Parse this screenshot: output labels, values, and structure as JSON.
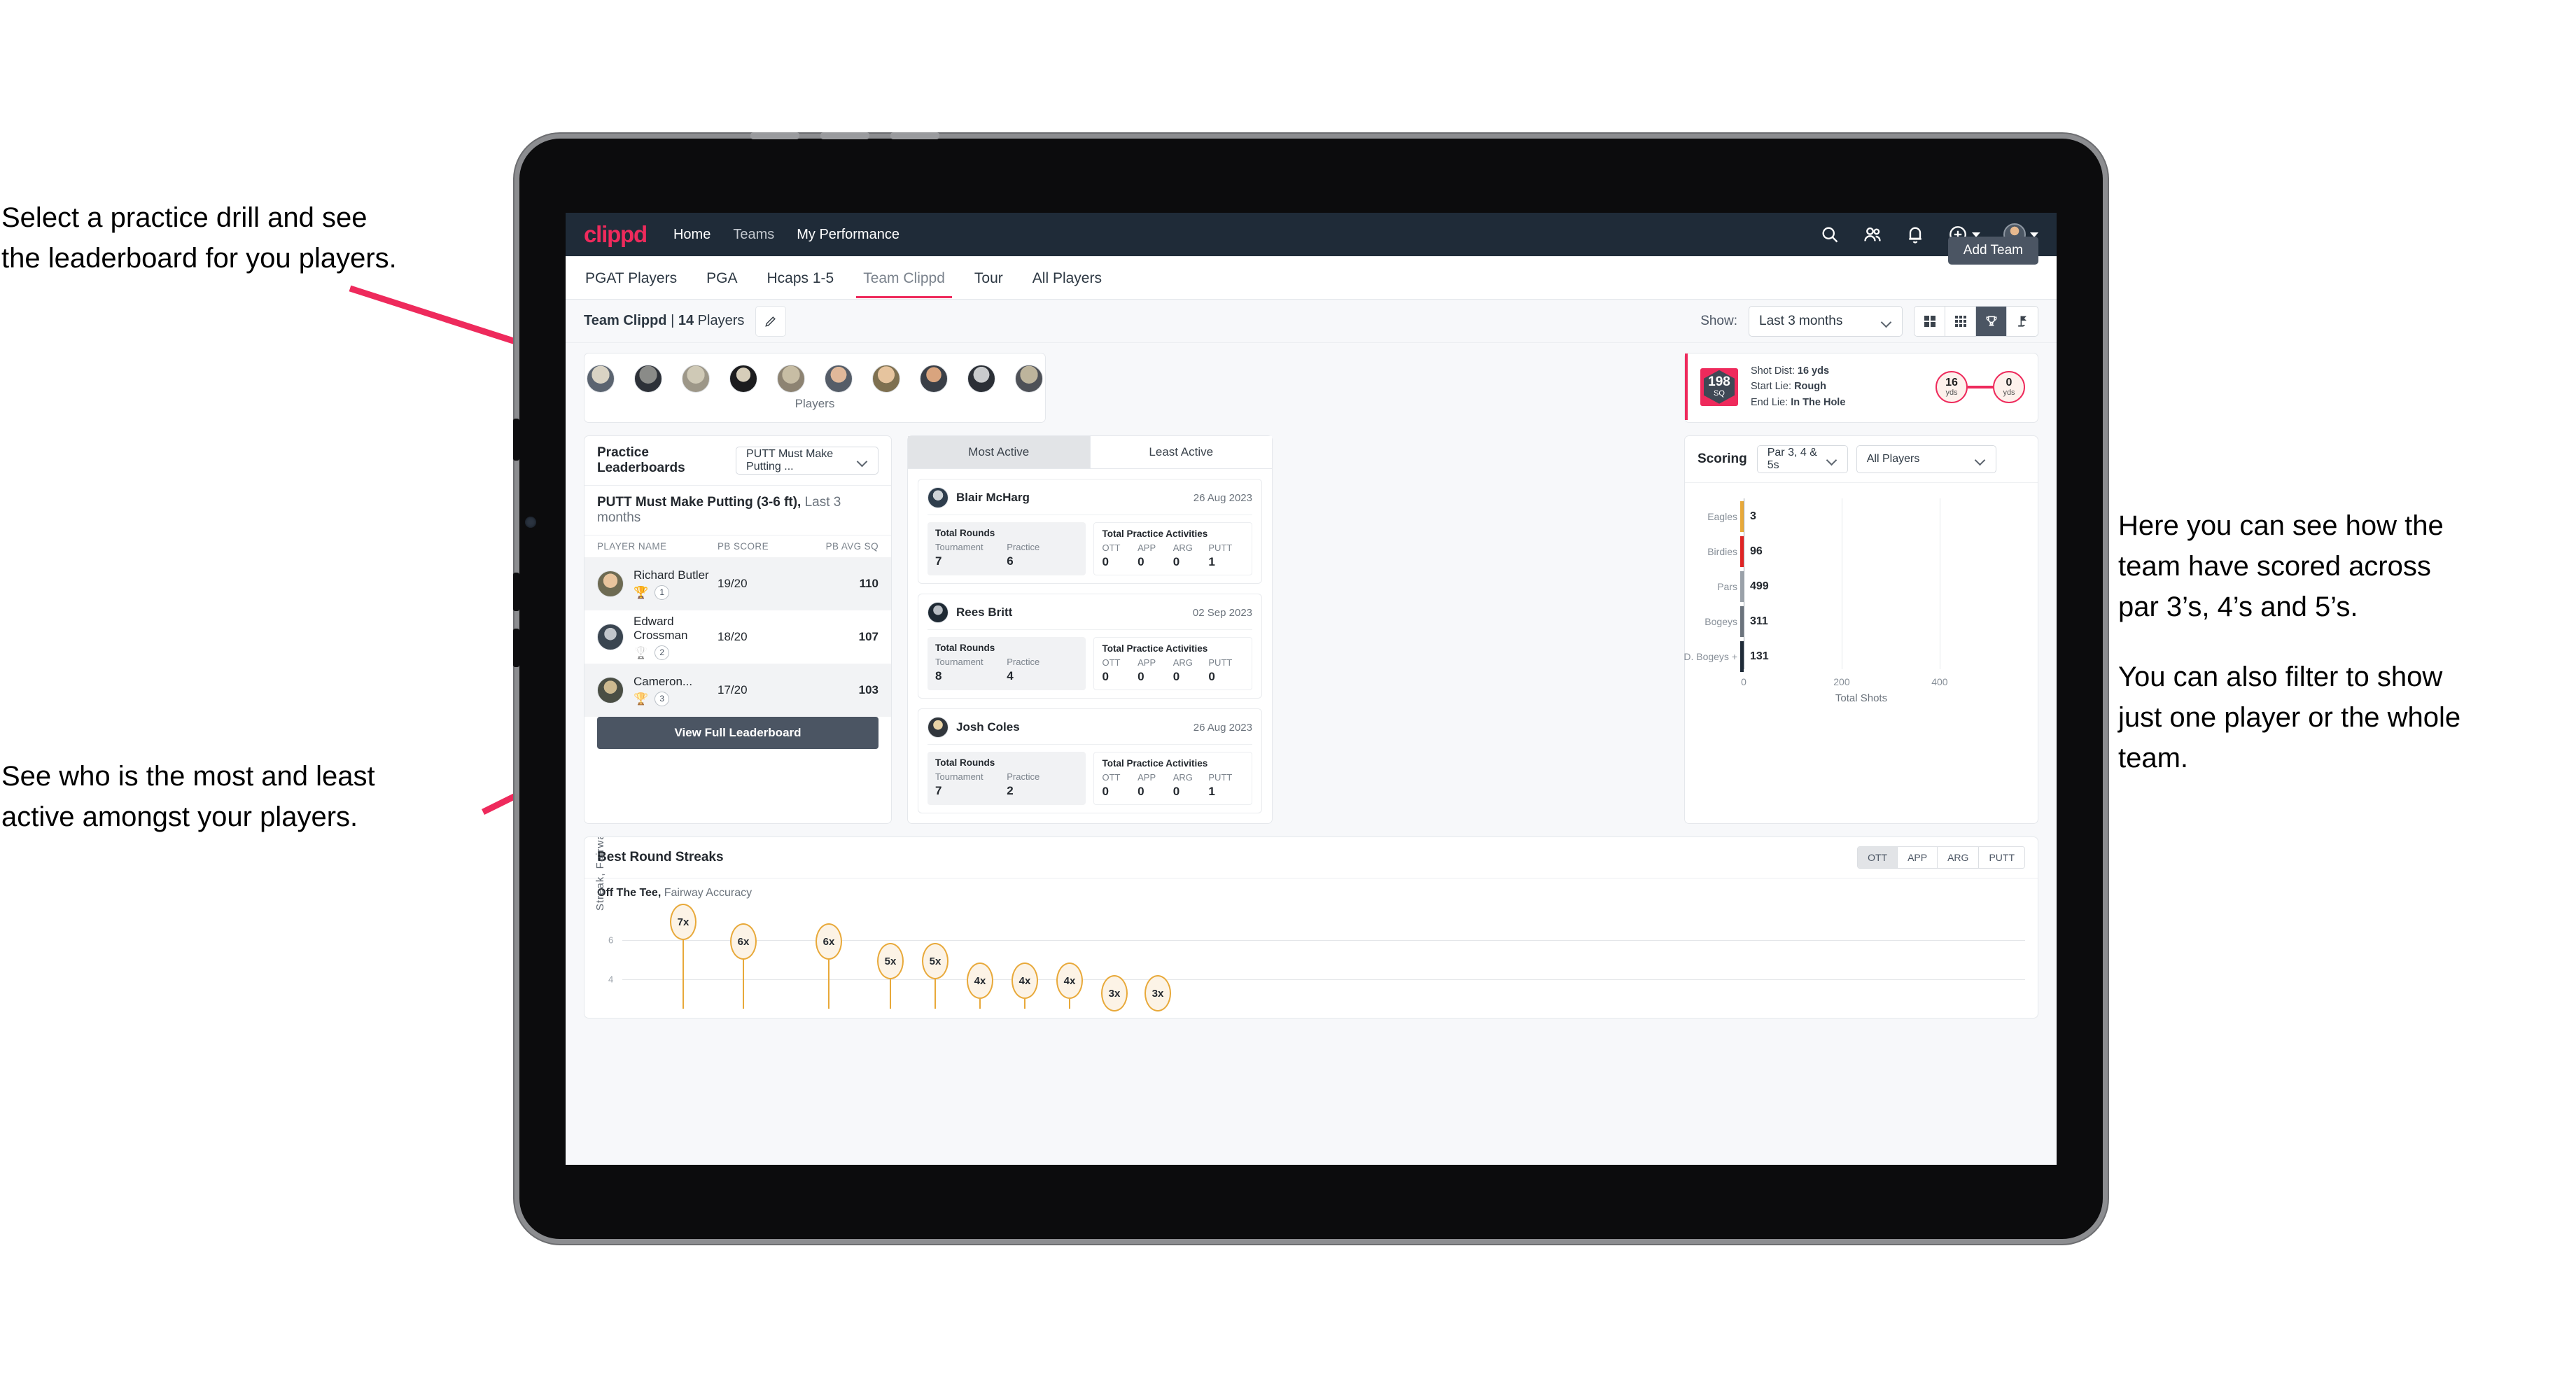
{
  "annotations": {
    "top_left": [
      "Select a practice drill and see",
      "the leaderboard for you players."
    ],
    "bottom_left": [
      "See who is the most and least",
      "active amongst your players."
    ],
    "right_1": [
      "Here you can see how the",
      "team have scored across",
      "par 3’s, 4’s and 5’s."
    ],
    "right_2": [
      "You can also filter to show",
      "just one player or the whole",
      "team."
    ]
  },
  "app": {
    "logo": "clippd",
    "nav": [
      {
        "label": "Home",
        "active": true
      },
      {
        "label": "Teams",
        "active": false
      },
      {
        "label": "My Performance",
        "active": true
      }
    ],
    "icons": [
      "search-icon",
      "people-icon",
      "bell-icon",
      "plus-circle-icon",
      "avatar"
    ],
    "accent": "#ee2a5c",
    "header_bg": "#1f2b38"
  },
  "tabs": [
    {
      "label": "PGAT Players",
      "active": false
    },
    {
      "label": "PGA",
      "active": false
    },
    {
      "label": "Hcaps 1-5",
      "active": false
    },
    {
      "label": "Team Clippd",
      "active": true
    },
    {
      "label": "Tour",
      "active": false
    },
    {
      "label": "All Players",
      "active": false
    }
  ],
  "add_team_button": "Add Team",
  "toolbar": {
    "team_name": "Team Clippd",
    "separator": "|",
    "player_count": "14",
    "players_word": "Players",
    "edit_icon": "pencil-icon",
    "show_label": "Show:",
    "range_value": "Last 3 months",
    "view_buttons": [
      "grid-large-icon",
      "grid-small-icon",
      "trophy-icon",
      "flag-icon"
    ],
    "active_view": "trophy-icon"
  },
  "players_strip": {
    "label": "Players",
    "count": 10
  },
  "shot_card": {
    "sq_value": "198",
    "sq_unit": "SQ",
    "lines": [
      {
        "label": "Shot Dist:",
        "value": "16 yds"
      },
      {
        "label": "Start Lie:",
        "value": "Rough"
      },
      {
        "label": "End Lie:",
        "value": "In The Hole"
      }
    ],
    "start_dist": {
      "n": "16",
      "u": "yds"
    },
    "end_dist": {
      "n": "0",
      "u": "yds"
    }
  },
  "leaderboard": {
    "title": "Practice Leaderboards",
    "drill_select": "PUTT Must Make Putting ...",
    "subtitle_bold": "PUTT Must Make Putting (3-6 ft),",
    "subtitle_dim": "Last 3 months",
    "columns": [
      "PLAYER NAME",
      "PB SCORE",
      "PB AVG SQ"
    ],
    "rows": [
      {
        "name": "Richard Butler",
        "rank": "1",
        "trophy": "gold",
        "score": "19/20",
        "sq": "110"
      },
      {
        "name": "Edward Crossman",
        "rank": "2",
        "trophy": "silver",
        "score": "18/20",
        "sq": "107"
      },
      {
        "name": "Cameron...",
        "rank": "3",
        "trophy": "bronze",
        "score": "17/20",
        "sq": "103"
      }
    ],
    "button": "View Full Leaderboard"
  },
  "activity": {
    "tabs": [
      {
        "label": "Most Active",
        "active": true
      },
      {
        "label": "Least Active",
        "active": false
      }
    ],
    "rounds_title": "Total Rounds",
    "practice_title": "Total Practice Activities",
    "rounds_keys": [
      "Tournament",
      "Practice"
    ],
    "practice_keys": [
      "OTT",
      "APP",
      "ARG",
      "PUTT"
    ],
    "cards": [
      {
        "name": "Blair McHarg",
        "date": "26 Aug 2023",
        "rounds": [
          "7",
          "6"
        ],
        "practice": [
          "0",
          "0",
          "0",
          "1"
        ]
      },
      {
        "name": "Rees Britt",
        "date": "02 Sep 2023",
        "rounds": [
          "8",
          "4"
        ],
        "practice": [
          "0",
          "0",
          "0",
          "0"
        ]
      },
      {
        "name": "Josh Coles",
        "date": "26 Aug 2023",
        "rounds": [
          "7",
          "2"
        ],
        "practice": [
          "0",
          "0",
          "0",
          "1"
        ]
      }
    ]
  },
  "scoring": {
    "title": "Scoring",
    "par_select": "Par 3, 4 & 5s",
    "player_select": "All Players"
  },
  "streaks": {
    "title": "Best Round Streaks",
    "segments": [
      {
        "label": "OTT",
        "active": true
      },
      {
        "label": "APP",
        "active": false
      },
      {
        "label": "ARG",
        "active": false
      },
      {
        "label": "PUTT",
        "active": false
      }
    ],
    "sub_bold": "Off The Tee,",
    "sub_dim": "Fairway Accuracy"
  },
  "chart_data": [
    {
      "type": "bar",
      "orientation": "horizontal",
      "title": "Scoring",
      "categories": [
        "Eagles",
        "Birdies",
        "Pars",
        "Bogeys",
        "D. Bogeys +"
      ],
      "values": [
        3,
        96,
        499,
        311,
        131
      ],
      "cap_colors": [
        "#e8a93a",
        "#e02424",
        "#9aa1a9",
        "#6b737c",
        "#1f2b38"
      ],
      "xlabel": "Total Shots",
      "ylabel": "",
      "xticks": [
        0,
        200,
        400
      ],
      "xlim": [
        0,
        560
      ],
      "grid": true,
      "legend": "none"
    },
    {
      "type": "lollipop",
      "title": "Best Round Streaks",
      "subtitle": "Off The Tee, Fairway Accuracy",
      "ylabel": "Streak, Fairway Accuracy",
      "categories": [
        "",
        "",
        "",
        "",
        "",
        "",
        "",
        "",
        "",
        ""
      ],
      "labels": [
        "7x",
        "6x",
        "6x",
        "5x",
        "5x",
        "4x",
        "4x",
        "4x",
        "3x",
        "3x"
      ],
      "values": [
        7,
        6,
        6,
        5,
        5,
        4,
        4,
        4,
        3,
        3
      ],
      "yticks": [
        4,
        6
      ],
      "ylim": [
        0,
        7.6
      ],
      "marker_color": "#fcf3e6",
      "marker_border": "#e8a93a",
      "grid": true,
      "legend": "none"
    }
  ]
}
